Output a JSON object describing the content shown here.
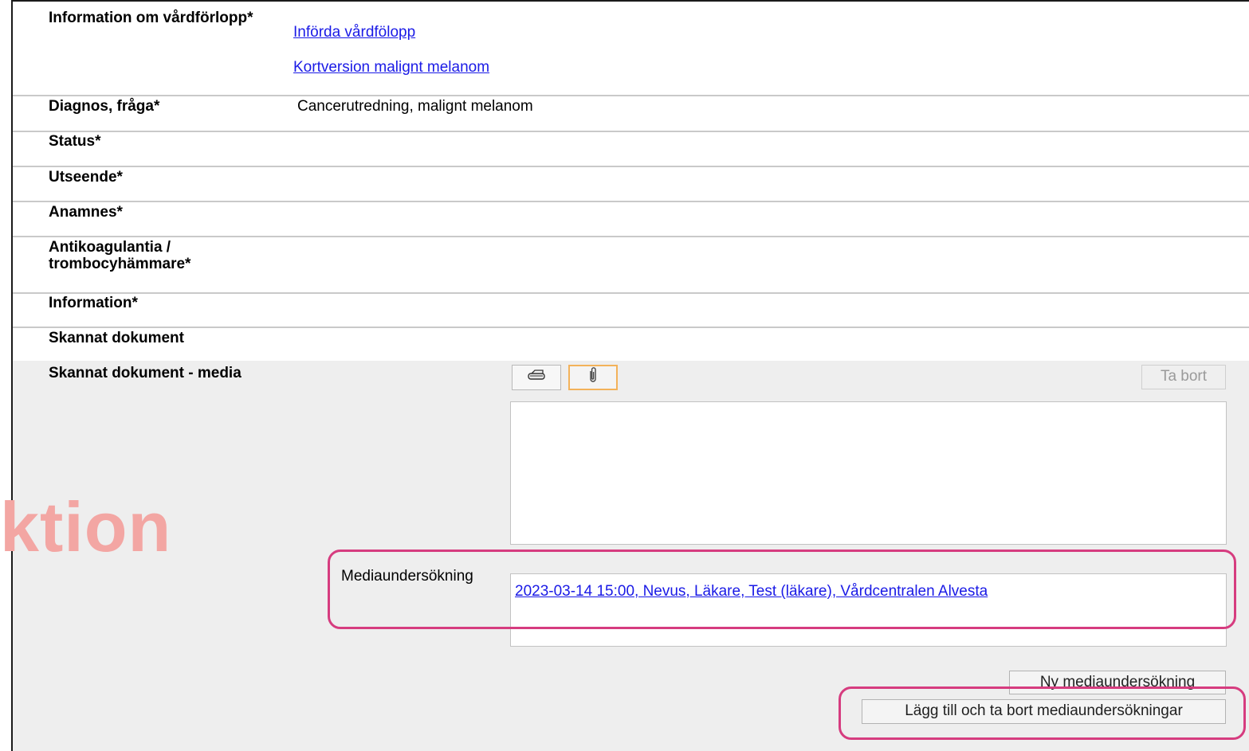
{
  "rows": {
    "vardforlopp_label": "Information om vårdförlopp*",
    "vardforlopp_link1": "Införda vårdfölopp",
    "vardforlopp_link2": "Kortversion malignt melanom",
    "diagnos_label": "Diagnos, fråga*",
    "diagnos_value": "Cancerutredning, malignt melanom",
    "status_label": "Status*",
    "utseende_label": "Utseende*",
    "anamnes_label": "Anamnes*",
    "antikoag_label_line1": "Antikoagulantia /",
    "antikoag_label_line2": "trombocyhämmare*",
    "information_label": "Information*",
    "skannat_label": "Skannat dokument",
    "skannat_media_label": "Skannat dokument - media"
  },
  "media": {
    "scan_icon": "scanner-icon",
    "attach_icon": "paperclip-icon",
    "remove_button": "Ta bort",
    "mediaundersokning_label": "Mediaundersökning",
    "mediaundersokning_link": "2023-03-14 15:00, Nevus, Läkare, Test (läkare), Vårdcentralen Alvesta ",
    "new_button": "Ny mediaundersökning",
    "add_remove_button": "Lägg till och ta bort mediaundersökningar"
  },
  "watermark": "ktion",
  "colors": {
    "link": "#1a1ae6",
    "highlight": "#d63c7f",
    "watermark": "#f3a6a3",
    "panel_bg": "#eeeeee"
  }
}
